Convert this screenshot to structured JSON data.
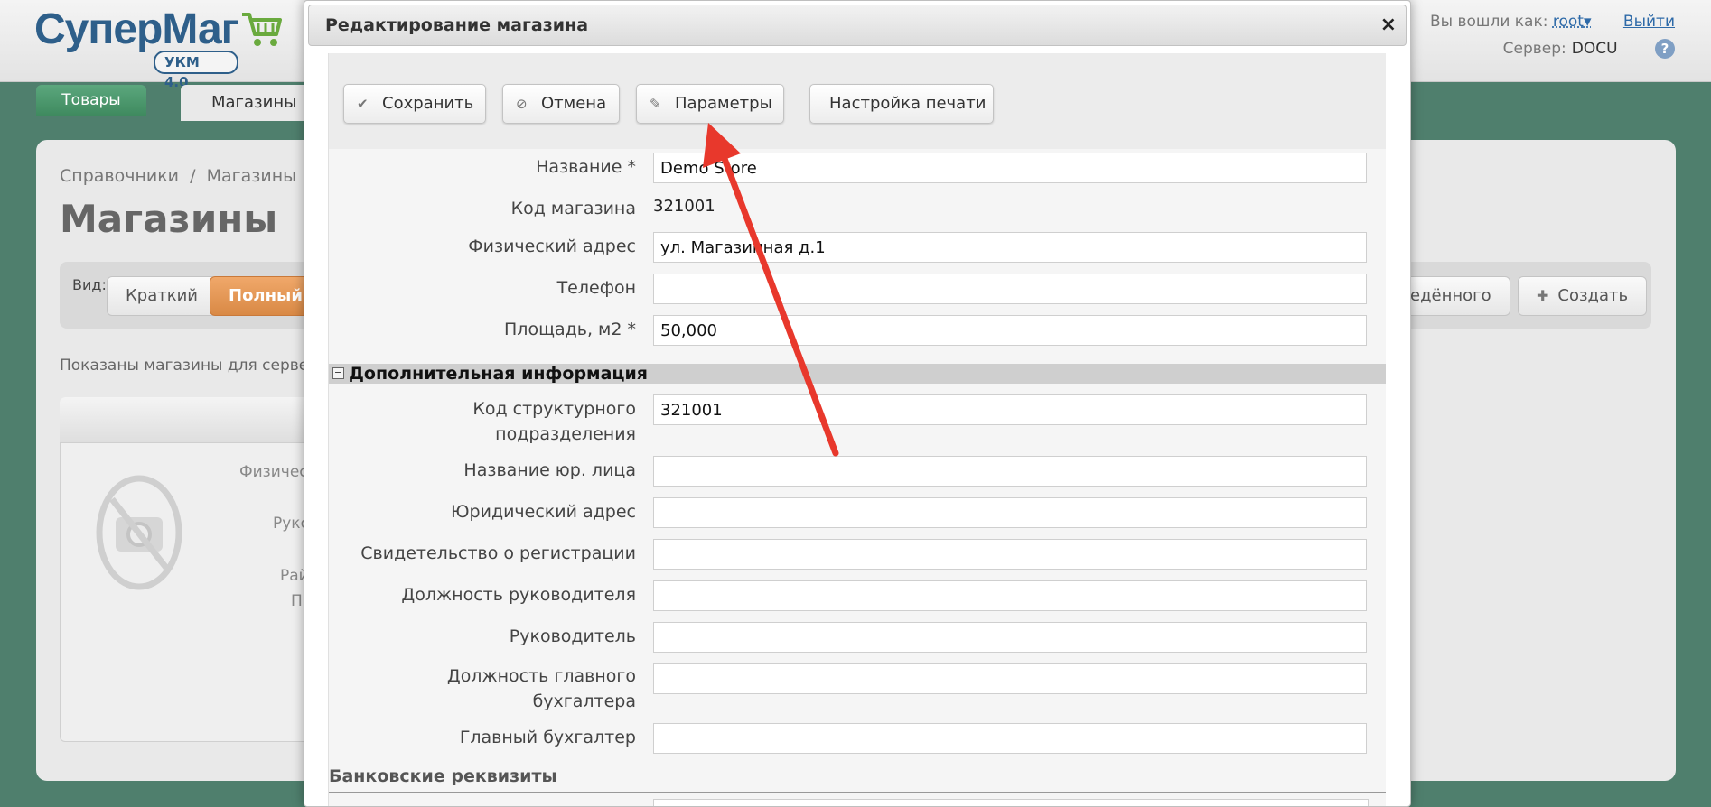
{
  "app": {
    "logo_text_1": "Супер",
    "logo_text_2": "Маг",
    "logo_badge": "УКМ 4.0",
    "user_prefix": "Вы вошли как:",
    "user_name": "root",
    "user_dropdown": "▾",
    "logout": "Выйти",
    "server_label": "Сервер:",
    "server_value": "DOCU",
    "help": "?"
  },
  "nav": {
    "tab_goods": "Товары",
    "tab_stores": "Магазины"
  },
  "page": {
    "breadcrumb": "Справочники  /  Магазины",
    "title": "Магазины",
    "view_label": "Вид:",
    "view_short": "Краткий",
    "view_full": "Полный",
    "btn_related_partial": "едённого",
    "btn_create": "Создать",
    "shown_text": "Показаны магазины для сервера",
    "card_labels": [
      "Физичес",
      "Руко",
      "Рай",
      "П"
    ]
  },
  "modal": {
    "title": "Редактирование магазина",
    "close": "×",
    "toolbar": {
      "save": "Сохранить",
      "cancel": "Отмена",
      "params": "Параметры",
      "print": "Настройка печати"
    },
    "fields": {
      "name_label": "Название *",
      "name_value": "Demo Store",
      "code_label": "Код магазина",
      "code_value": "321001",
      "address_label": "Физический адрес",
      "address_value": "ул. Магазинная д.1",
      "phone_label": "Телефон",
      "phone_value": "",
      "area_label": "Площадь, м2 *",
      "area_value": "50,000"
    },
    "extra_section": {
      "title": "Дополнительная информация",
      "toggle": "−",
      "struct_label_1": "Код структурного",
      "struct_label_2": "подразделения",
      "struct_value": "321001",
      "legal_name_label": "Название юр. лица",
      "legal_address_label": "Юридический адрес",
      "reg_cert_label": "Свидетельство о регистрации",
      "head_position_label": "Должность руководителя",
      "head_label": "Руководитель",
      "chief_acc_pos_label_1": "Должность главного",
      "chief_acc_pos_label_2": "бухгалтера",
      "chief_acc_label": "Главный бухгалтер"
    },
    "bank_section": {
      "title": "Банковские реквизиты"
    }
  },
  "colors": {
    "background": "#4f7f6d",
    "annotation_arrow": "#e8382c",
    "brand": "#2e5f8a",
    "active_view": "#e0904e"
  }
}
